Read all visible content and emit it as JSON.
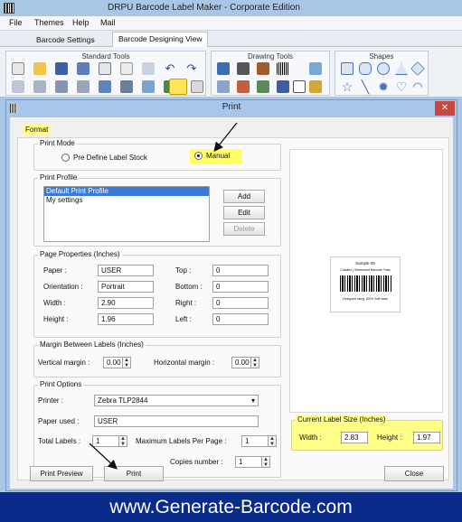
{
  "app": {
    "title": "DRPU Barcode Label Maker - Corporate Edition",
    "window_controls": [
      "–",
      "□",
      "✕"
    ]
  },
  "menu": {
    "items": [
      "File",
      "Themes",
      "Help",
      "Mail"
    ]
  },
  "tabs": [
    "Barcode Settings",
    "Barcode Designing View"
  ],
  "ribbon": {
    "groups": [
      "Standard Tools",
      "Drawing Tools",
      "Shapes"
    ]
  },
  "dialog": {
    "title": "Print",
    "close": "✕",
    "format_tab": "Format",
    "print_mode": {
      "label": "Print Mode",
      "options": [
        "Pre Define Label Stock",
        "Manual"
      ],
      "selected": "Manual"
    },
    "print_profile": {
      "label": "Print Profile",
      "items": [
        "Default Print Profile",
        "My settings"
      ],
      "selected_index": 0,
      "buttons": {
        "add": "Add",
        "edit": "Edit",
        "delete": "Delete"
      }
    },
    "page_properties": {
      "label": "Page Properties (Inches)",
      "paper_label": "Paper :",
      "paper": "USER",
      "orientation_label": "Orientation :",
      "orientation": "Portrait",
      "width_label": "Width :",
      "width": "2.90",
      "height_label": "Height :",
      "height": "1.96",
      "top_label": "Top :",
      "top": "0",
      "bottom_label": "Bottom :",
      "bottom": "0",
      "right_label": "Right :",
      "right": "0",
      "left_label": "Left :",
      "left": "0"
    },
    "margin": {
      "label": "Margin Between Labels (Inches)",
      "vertical_label": "Vertical margin :",
      "vertical": "0.00",
      "horizontal_label": "Horizontal margin :",
      "horizontal": "0.00"
    },
    "print_options": {
      "label": "Print Options",
      "printer_label": "Printer :",
      "printer": "Zebra TLP2844",
      "paper_used_label": "Paper used :",
      "paper_used": "USER",
      "total_labels_label": "Total Labels :",
      "total_labels": "1",
      "max_labels_label": "Maximum Labels Per Page :",
      "max_labels": "1",
      "copies_label": "Copies number :",
      "copies": "1"
    },
    "label_size": {
      "label": "Current Label Size (Inches)",
      "width_label": "Width :",
      "width": "2.83",
      "height_label": "Height :",
      "height": "1.97"
    },
    "preview": {
      "line1": "Sample 09",
      "line2": "Cataline | Seemeand Barcode Trats",
      "line3": "Designed using 100% Soft ware"
    },
    "buttons": {
      "print_preview": "Print Preview",
      "print": "Print",
      "close": "Close"
    }
  },
  "banner": {
    "text": "www.Generate-Barcode.com"
  },
  "colors": {
    "highlight": "#ffff66",
    "title_bar": "#a8c7e6",
    "banner": "#0b2b8a"
  }
}
